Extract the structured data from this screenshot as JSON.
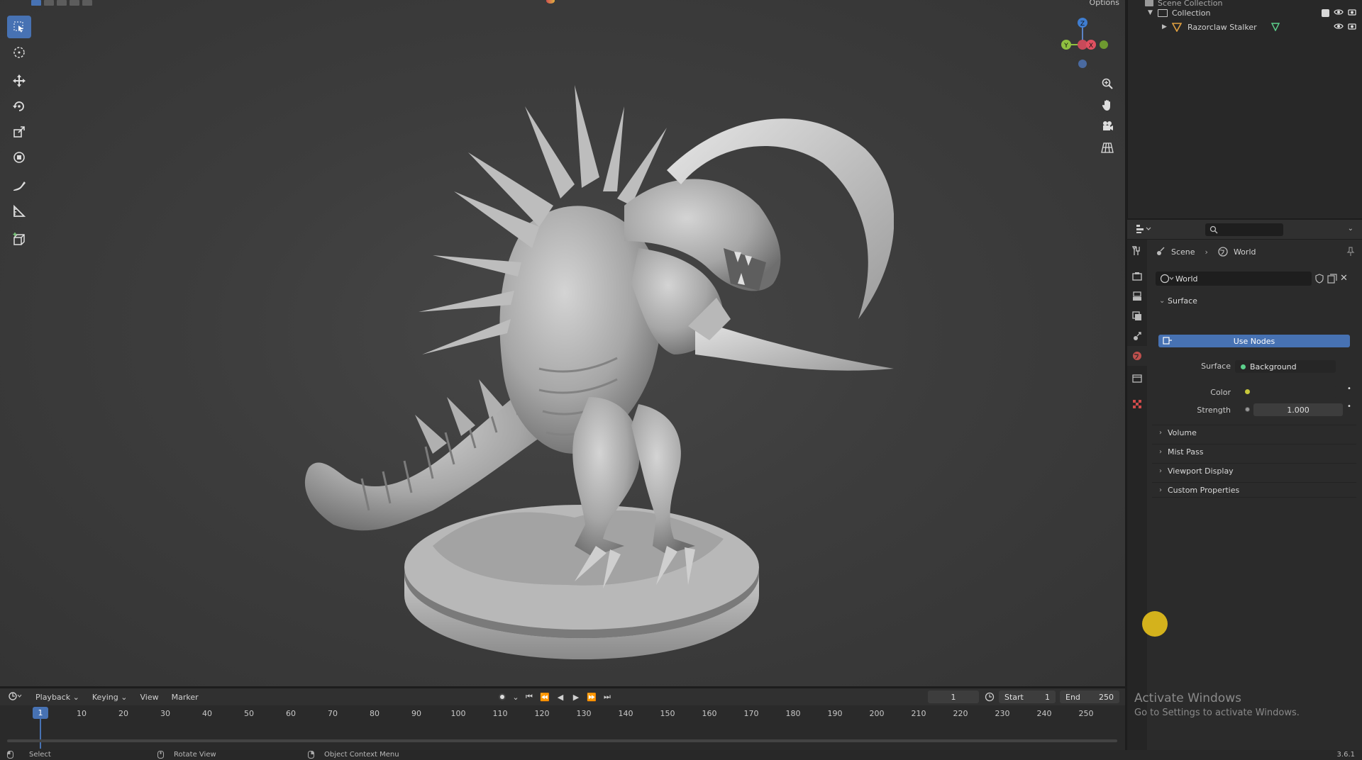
{
  "viewport": {
    "options_label": "Options",
    "gizmo": {
      "z": "Z",
      "y": "Y",
      "x": "X"
    },
    "tools": [
      "select-box",
      "cursor",
      "move",
      "rotate",
      "scale",
      "transform",
      "annotate",
      "measure",
      "add-cube"
    ],
    "nav_buttons": [
      "zoom",
      "pan",
      "camera",
      "perspective-grid"
    ]
  },
  "outliner": {
    "scene_collection": "Scene Collection",
    "collection": "Collection",
    "object": "Razorclaw Stalker"
  },
  "properties": {
    "search_placeholder": "",
    "breadcrumb": {
      "scene": "Scene",
      "world": "World"
    },
    "world_name": "World",
    "surface_panel": "Surface",
    "use_nodes": "Use Nodes",
    "surface_label": "Surface",
    "surface_value": "Background",
    "color_label": "Color",
    "strength_label": "Strength",
    "strength_value": "1.000",
    "collapsed_panels": [
      "Volume",
      "Mist Pass",
      "Viewport Display",
      "Custom Properties"
    ],
    "tabs": [
      "tool",
      "render",
      "output",
      "view-layer",
      "scene",
      "world",
      "collection",
      "texture"
    ],
    "active_tab": "world"
  },
  "timeline": {
    "menus": [
      "Playback",
      "Keying",
      "View",
      "Marker"
    ],
    "current_frame": "1",
    "start_label": "Start",
    "start_value": "1",
    "end_label": "End",
    "end_value": "250",
    "ruler_current": "1",
    "ruler_ticks": [
      "10",
      "20",
      "30",
      "40",
      "50",
      "60",
      "70",
      "80",
      "90",
      "100",
      "110",
      "120",
      "130",
      "140",
      "150",
      "160",
      "170",
      "180",
      "190",
      "200",
      "210",
      "220",
      "230",
      "240",
      "250"
    ]
  },
  "statusbar": {
    "select": "Select",
    "rotate_view": "Rotate View",
    "object_context_menu": "Object Context Menu",
    "version": "3.6.1"
  },
  "watermark": {
    "title": "Activate Windows",
    "subtitle": "Go to Settings to activate Windows."
  },
  "colors": {
    "accent": "#4772b3",
    "world_tab": "#e08050",
    "cursor_highlight": "#d4b21c",
    "object_icon": "#e0a040",
    "mesh_data_icon": "#5cd08c"
  }
}
